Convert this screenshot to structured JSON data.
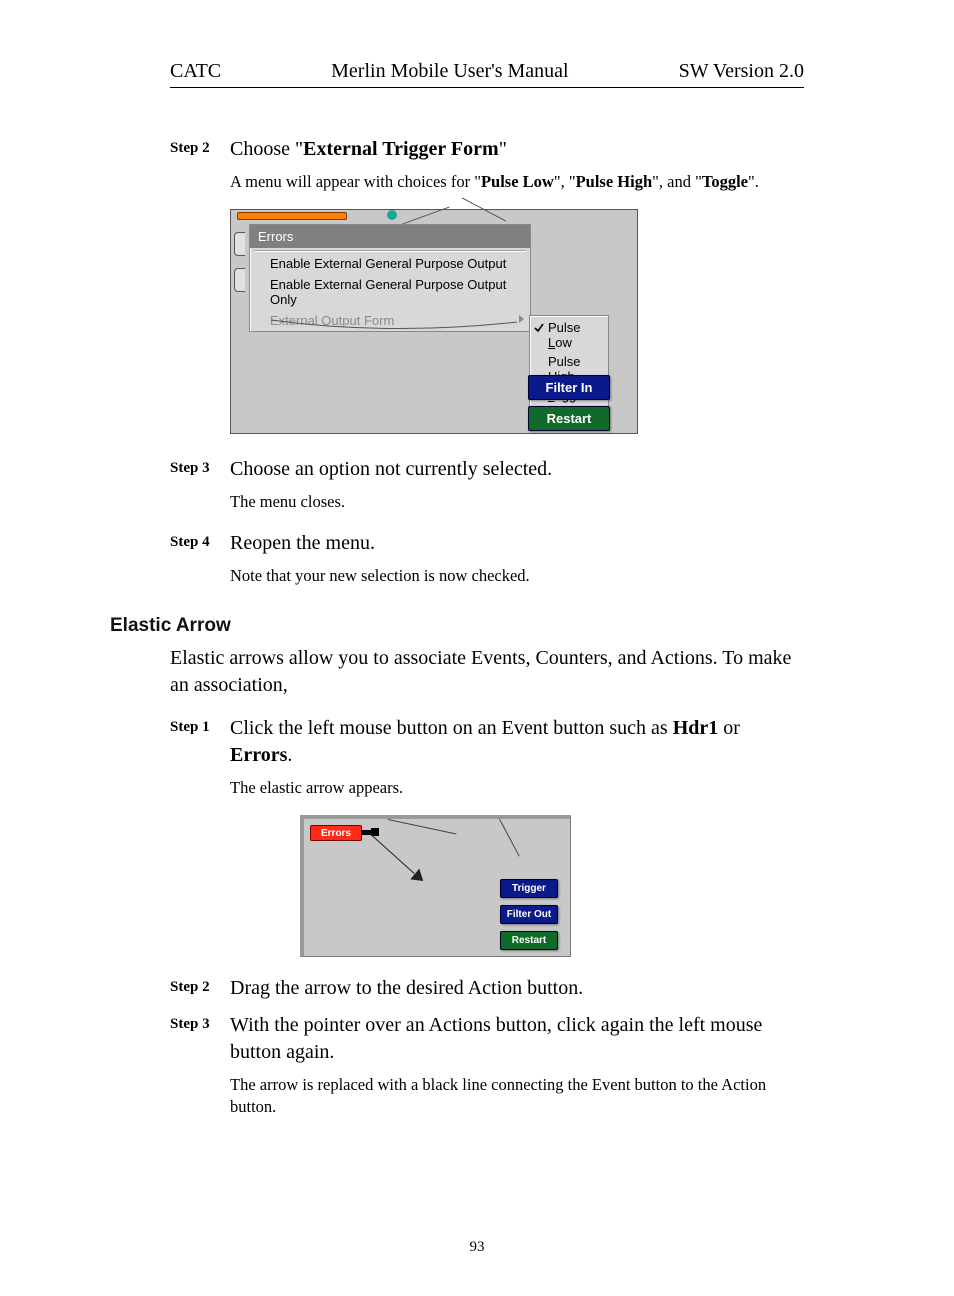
{
  "header": {
    "left": "CATC",
    "center": "Merlin Mobile User's Manual",
    "right": "SW Version 2.0"
  },
  "steps_a": [
    {
      "label": "Step 2",
      "text_pre": "Choose \"",
      "text_bold": "External Trigger Form",
      "text_post": "\"",
      "note_pre": "A menu will appear with choices for \"",
      "note_b1": "Pulse Low",
      "note_mid1": "\", \"",
      "note_b2": "Pulse High",
      "note_mid2": "\", and \"",
      "note_b3": "Toggle",
      "note_end": "\"."
    },
    {
      "label": "Step 3",
      "text": "Choose an option not currently selected.",
      "note": "The menu closes."
    },
    {
      "label": "Step 4",
      "text": "Reopen the menu.",
      "note": "Note that your new selection is now checked."
    }
  ],
  "section": {
    "title": "Elastic Arrow",
    "intro": "Elastic arrows allow you to associate Events, Counters, and Actions.  To make an association,"
  },
  "steps_b": [
    {
      "label": "Step 1",
      "text_pre": "Click the left mouse button on an Event button such as ",
      "text_b1": "Hdr1",
      "text_mid": " or ",
      "text_b2": "Errors",
      "text_post": ".",
      "note": "The elastic arrow appears."
    },
    {
      "label": "Step 2",
      "text": "Drag the arrow to the desired Action button."
    },
    {
      "label": "Step 3",
      "text": "With the pointer over an Actions button, click again the left mouse button again.",
      "note": "The arrow is replaced with a black line connecting the Event button to the Action button."
    }
  ],
  "fig1": {
    "menu_header": "Errors",
    "items": {
      "enable": "Enable External General Purpose Output",
      "enable_only": "Enable External General Purpose Output Only",
      "output_form": "External Output Form"
    },
    "submenu": {
      "low_pre": "Pulse ",
      "low_u": "L",
      "low_post": "ow",
      "high_pre": "Pulse ",
      "high_u": "H",
      "high_post": "igh",
      "toggle_u": "T",
      "toggle_post": "oggle"
    },
    "buttons": {
      "filter": "Filter In",
      "restart": "Restart"
    }
  },
  "fig2": {
    "errors": "Errors",
    "buttons": {
      "trigger": "Trigger",
      "filter": "Filter Out",
      "restart": "Restart"
    }
  },
  "pagenum": "93"
}
